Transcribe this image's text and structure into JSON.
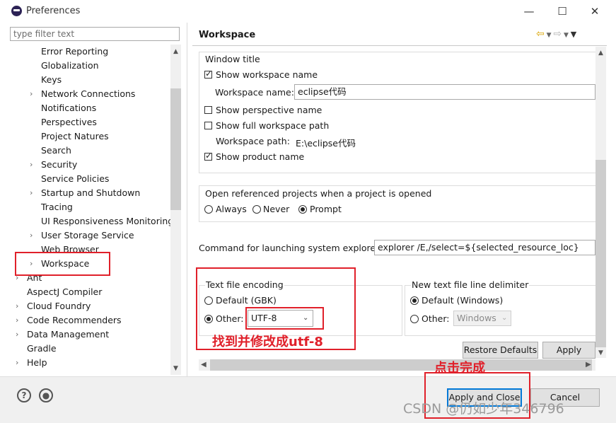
{
  "window": {
    "title": "Preferences",
    "minimize": "—",
    "maximize": "☐",
    "close": "✕"
  },
  "filter": {
    "placeholder": "type filter text"
  },
  "tree": {
    "items": [
      {
        "label": "Error Reporting",
        "has_children": false
      },
      {
        "label": "Globalization",
        "has_children": false
      },
      {
        "label": "Keys",
        "has_children": false
      },
      {
        "label": "Network Connections",
        "has_children": true
      },
      {
        "label": "Notifications",
        "has_children": false
      },
      {
        "label": "Perspectives",
        "has_children": false
      },
      {
        "label": "Project Natures",
        "has_children": false
      },
      {
        "label": "Search",
        "has_children": false
      },
      {
        "label": "Security",
        "has_children": true
      },
      {
        "label": "Service Policies",
        "has_children": false
      },
      {
        "label": "Startup and Shutdown",
        "has_children": true
      },
      {
        "label": "Tracing",
        "has_children": false
      },
      {
        "label": "UI Responsiveness Monitoring",
        "has_children": false
      },
      {
        "label": "User Storage Service",
        "has_children": true
      },
      {
        "label": "Web Browser",
        "has_children": false
      },
      {
        "label": "Workspace",
        "has_children": true,
        "selected": true
      }
    ],
    "top_items": [
      {
        "label": "Ant",
        "has_children": true
      },
      {
        "label": "AspectJ Compiler",
        "has_children": false
      },
      {
        "label": "Cloud Foundry",
        "has_children": true
      },
      {
        "label": "Code Recommenders",
        "has_children": true
      },
      {
        "label": "Data Management",
        "has_children": true
      },
      {
        "label": "Gradle",
        "has_children": false
      },
      {
        "label": "Help",
        "has_children": true
      }
    ]
  },
  "page": {
    "title": "Workspace",
    "window_title": {
      "group_label": "Window title",
      "show_workspace_name": {
        "label": "Show workspace name",
        "checked": true
      },
      "workspace_name_label": "Workspace name:",
      "workspace_name_value": "eclipse代码",
      "show_perspective_name": {
        "label": "Show perspective name",
        "checked": false
      },
      "show_full_workspace_path": {
        "label": "Show full workspace path",
        "checked": false
      },
      "workspace_path_label": "Workspace path:",
      "workspace_path_value": "E:\\eclipse代码",
      "show_product_name": {
        "label": "Show product name",
        "checked": true
      }
    },
    "open_referenced": {
      "label": "Open referenced projects when a project is opened",
      "options": [
        "Always",
        "Never",
        "Prompt"
      ],
      "selected": "Prompt"
    },
    "explorer": {
      "label": "Command for launching system explorer:",
      "value": "explorer /E,/select=${selected_resource_loc}"
    },
    "encoding": {
      "group_label": "Text file encoding",
      "default_label": "Default (GBK)",
      "other_label": "Other:",
      "selected": "Other",
      "other_value": "UTF-8"
    },
    "line_delimiter": {
      "group_label": "New text file line delimiter",
      "default_label": "Default (Windows)",
      "other_label": "Other:",
      "selected": "Default",
      "other_value": "Windows"
    },
    "restore_defaults": "Restore Defaults",
    "apply": "Apply"
  },
  "bottom": {
    "apply_and_close": "Apply and Close",
    "cancel": "Cancel"
  },
  "annotations": {
    "encoding_note": "找到并修改成utf-8",
    "click_note": "点击完成",
    "accent_color": "#e0202a"
  },
  "watermark": "CSDN @仍如少年346796"
}
